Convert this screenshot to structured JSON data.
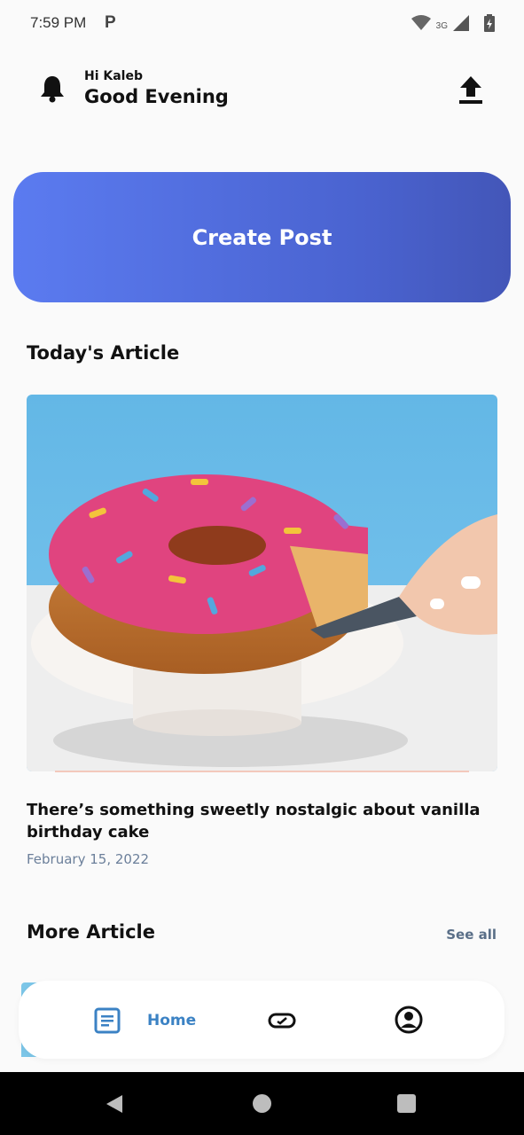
{
  "status_bar": {
    "time": "7:59 PM",
    "notification_letter": "P",
    "network": "3G"
  },
  "header": {
    "greeting_small": "Hi Kaleb",
    "greeting_big": "Good Evening"
  },
  "create_post": {
    "label": "Create Post"
  },
  "todays_article": {
    "section_title": "Today's Article",
    "title": "There’s something sweetly nostalgic about vanilla birthday cake",
    "date": "February 15, 2022"
  },
  "more_article": {
    "section_title": "More Article",
    "see_all": "See all"
  },
  "bottom_nav": {
    "home_label": "Home",
    "items": [
      "home",
      "ticket",
      "profile"
    ]
  },
  "colors": {
    "accent": "#4a63d0",
    "nav_active": "#3b82c4",
    "date": "#6b7f9a"
  }
}
